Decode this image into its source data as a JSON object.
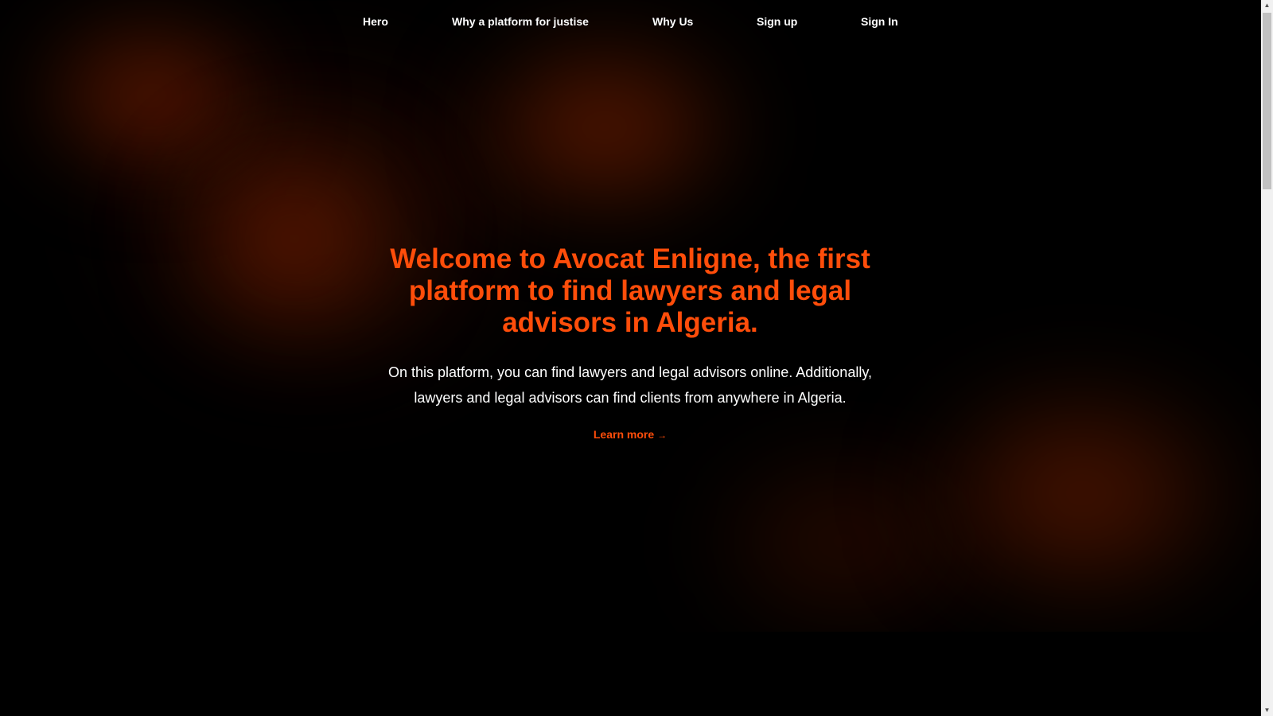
{
  "nav": {
    "items": [
      {
        "label": "Hero"
      },
      {
        "label": "Why a platform for justise"
      },
      {
        "label": "Why Us"
      },
      {
        "label": "Sign up"
      },
      {
        "label": "Sign In"
      }
    ]
  },
  "hero": {
    "headline": "Welcome to Avocat Enligne, the first platform to find lawyers and legal advisors in Algeria.",
    "description": "On this platform, you can find lawyers and legal advisors online. Additionally, lawyers and legal advisors can find clients from anywhere in Algeria.",
    "cta_label": "Learn more",
    "cta_arrow": "→"
  },
  "scrollbar": {
    "up_glyph": "▲",
    "down_glyph": "▼"
  },
  "colors": {
    "accent": "#ff4d0a",
    "background": "#000000",
    "glow": "#4a1800",
    "text": "#ffffff"
  },
  "icons": {
    "cta_arrow": "right-arrow-icon",
    "scroll_up": "scroll-up-arrow-icon",
    "scroll_down": "scroll-down-arrow-icon"
  }
}
